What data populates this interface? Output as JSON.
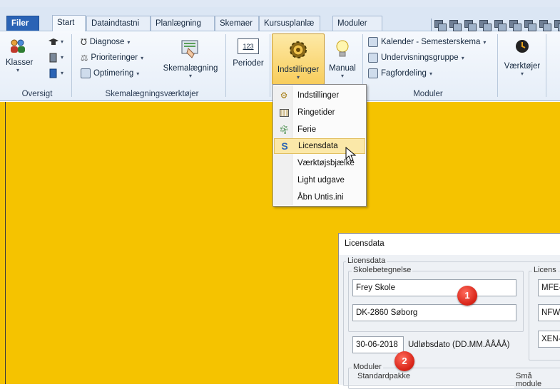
{
  "tabs": [
    "Filer",
    "Start",
    "Dataindtastni",
    "Planlægning",
    "Skemaer",
    "Kursusplanlæ",
    "Moduler"
  ],
  "ribbon": {
    "oversigt": {
      "group_label": "Oversigt",
      "klasser_label": "Klasser"
    },
    "skema": {
      "group_label": "Skemalægningsværktøjer",
      "diagnose": "Diagnose",
      "prioriteringer": "Prioriteringer",
      "optimering": "Optimering",
      "skemalaegning": "Skemalægning"
    },
    "perioder": {
      "label": "Perioder",
      "icon_text": "123"
    },
    "indstillinger": {
      "label": "Indstillinger"
    },
    "manual": {
      "label": "Manual"
    },
    "moduler": {
      "group_label": "Moduler",
      "kalender": "Kalender - Semesterskema",
      "undervisningsgruppe": "Undervisningsgruppe",
      "fagfordeling": "Fagfordeling"
    },
    "vaerktojer": {
      "label": "Værktøjer"
    }
  },
  "menu": {
    "items": [
      {
        "label": "Indstillinger",
        "icon": "gear-icon"
      },
      {
        "label": "Ringetider",
        "icon": "table-icon"
      },
      {
        "label": "Ferie",
        "icon": "palm-icon"
      },
      {
        "label": "Licensdata",
        "icon": "license-icon"
      },
      {
        "label": "Værktøjsbjælke",
        "icon": ""
      },
      {
        "label": "Light udgave",
        "icon": ""
      },
      {
        "label": "Åbn Untis.ini",
        "icon": ""
      }
    ],
    "hover_index": 3
  },
  "dialog": {
    "title": "Licensdata",
    "group_licensdata": "Licensdata",
    "group_skole": "Skolebetegnelse",
    "school_name": "Frey Skole",
    "school_address": "DK-2860 Søborg",
    "expiry_date": "30-06-2018",
    "expiry_label": "Udløbsdato (DD.MM.ÅÅÅÅ)",
    "group_licens": "Licens",
    "licens_fields": [
      "MFE-",
      "NFW",
      "XEN-"
    ],
    "group_moduler": "Moduler",
    "group_standard": "Standardpakke",
    "group_smaa": "Små module"
  },
  "badges": [
    "1",
    "2"
  ],
  "colors": {
    "workspace": "#f5c300",
    "file_tab": "#2a63b5",
    "badge": "#d9261a"
  }
}
